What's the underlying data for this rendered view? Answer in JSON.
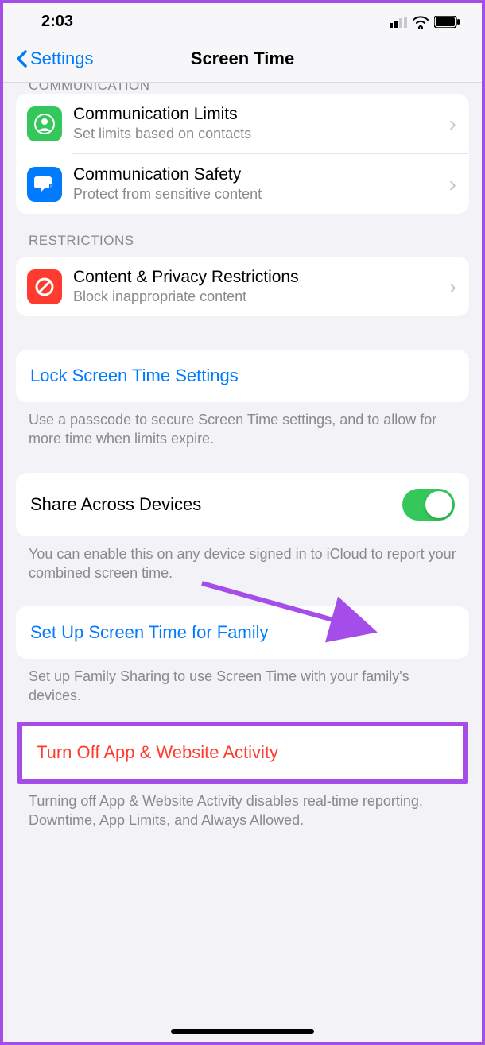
{
  "status": {
    "time": "2:03"
  },
  "nav": {
    "back": "Settings",
    "title": "Screen Time"
  },
  "sections": {
    "communication_header": "COMMUNICATION",
    "restrictions_header": "RESTRICTIONS"
  },
  "rows": {
    "comm_limits": {
      "title": "Communication Limits",
      "sub": "Set limits based on contacts"
    },
    "comm_safety": {
      "title": "Communication Safety",
      "sub": "Protect from sensitive content"
    },
    "content_privacy": {
      "title": "Content & Privacy Restrictions",
      "sub": "Block inappropriate content"
    },
    "lock": {
      "title": "Lock Screen Time Settings"
    },
    "share": {
      "title": "Share Across Devices",
      "on": true
    },
    "family": {
      "title": "Set Up Screen Time for Family"
    },
    "turnoff": {
      "title": "Turn Off App & Website Activity"
    }
  },
  "footers": {
    "lock": "Use a passcode to secure Screen Time settings, and to allow for more time when limits expire.",
    "share": "You can enable this on any device signed in to iCloud to report your combined screen time.",
    "family": "Set up Family Sharing to use Screen Time with your family's devices.",
    "turnoff": "Turning off App & Website Activity disables real-time reporting, Downtime, App Limits, and Always Allowed."
  }
}
